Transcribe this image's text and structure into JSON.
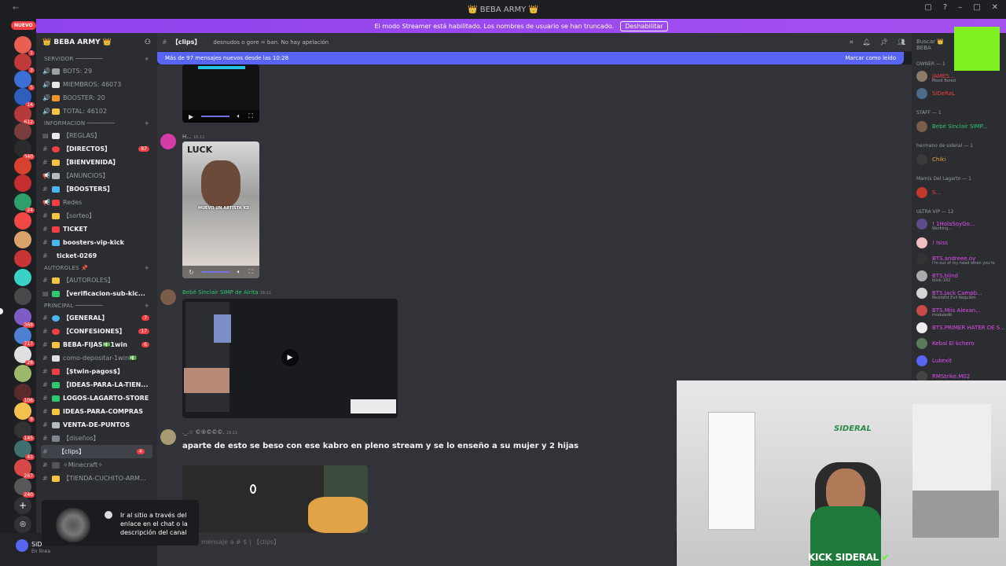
{
  "titlebar": {
    "title": "👑 BEBA ARMY 👑",
    "back": "←"
  },
  "banner": {
    "text": "El modo Streamer está habilitado. Los nombres de usuario se han truncado.",
    "button": "Deshabilitar"
  },
  "guild_bar": {
    "nuevo": "NUEVO"
  },
  "server": {
    "name": "👑 BEBA ARMY 👑"
  },
  "categories": {
    "servidor": "SERVIDOR ────────",
    "informacion": "INFORMACION ────────",
    "autoroles": "AUTOROLES 📌",
    "principal": "PRINCIPAL ────────"
  },
  "channels": [
    {
      "name": "BOTS: 29"
    },
    {
      "name": "MIEMBROS: 46073"
    },
    {
      "name": "BOOSTER: 20"
    },
    {
      "name": "TOTAL: 46102"
    },
    {
      "name": "【REGLAS】"
    },
    {
      "name": "【DIRECTOS】",
      "count": "87"
    },
    {
      "name": "【BIENVENIDA】"
    },
    {
      "name": "【ANUNCIOS】"
    },
    {
      "name": "【BOOSTERS】"
    },
    {
      "name": "Redes"
    },
    {
      "name": "【sorteo】"
    },
    {
      "name": "TICKET"
    },
    {
      "name": "boosters-vip-kick"
    },
    {
      "name": "ticket-0269"
    },
    {
      "name": "【AUTOROLES】"
    },
    {
      "name": "【verificacion-sub-kic..."
    },
    {
      "name": "【GENERAL】",
      "count": "7"
    },
    {
      "name": "【CONFESIONES】",
      "count": "17"
    },
    {
      "name": "BEBA-FIJAS💵1win",
      "count": "6"
    },
    {
      "name": "como-depositar-1win💵"
    },
    {
      "name": "【$twin-pagos$】"
    },
    {
      "name": "【IDEAS-PARA-LA-TIEN..."
    },
    {
      "name": "LOGOS-LAGARTO-STORE"
    },
    {
      "name": "IDEAS-PARA-COMPRAS"
    },
    {
      "name": "VENTA-DE-PUNTOS"
    },
    {
      "name": "【diseños】"
    },
    {
      "name": "【clips】",
      "count": "4"
    },
    {
      "name": "✧Minecraft✧"
    },
    {
      "name": "【TIENDA-CUCHITO-ARM..."
    }
  ],
  "user_panel": {
    "name": "SiD",
    "status": "En línea"
  },
  "topbar": {
    "channel": "【clips】",
    "topic": "desnudos o gore = ban. No hay apelación",
    "search": "Buscar 👑 BEBA"
  },
  "new_messages": {
    "text": "Más de 97 mensajes nuevos desde las 10:28",
    "mark": "Marcar como leído"
  },
  "messages": [
    {
      "author": "H...",
      "time": "16:11",
      "caption": "MUEVO UN ARTISTA XD"
    },
    {
      "author": "Bebé Sinclair SIMP de Airita",
      "time": "16:11"
    },
    {
      "author": "._.☆ ©®©©©.",
      "time": "16:11",
      "text": "aparte de esto se beso con ese kabro en pleno stream y se lo enseño a su mujer y 2 hijas"
    }
  ],
  "composer": {
    "placeholder": "mensaje a # $ | 【clips】"
  },
  "members": {
    "groups": [
      {
        "label": "OWNER — 1"
      },
      {
        "label": "STAFF — 1"
      },
      {
        "label": "hermano de sideral — 1"
      },
      {
        "label": "Mamis Del Lagarto — 1"
      },
      {
        "label": "ULTRA VIP — 12"
      }
    ],
    "people": [
      {
        "name": "JAMES...",
        "color": "#f23f43",
        "sub": "Mood Bored"
      },
      {
        "name": "SiDeRaL",
        "color": "#f23f43"
      },
      {
        "name": "Bebé Sinclair SIMP...",
        "color": "#2dc770"
      },
      {
        "name": "Chiki",
        "color": "#e8a23a"
      },
      {
        "name": "S...",
        "color": "#f23f43"
      },
      {
        "name": "! 1HolaSoyGo...",
        "color": "#e04ff0",
        "sub": "Working..."
      },
      {
        "name": "! Isiss",
        "color": "#e04ff0"
      },
      {
        "name": "BTS.andreee.oy",
        "color": "#e04ff0",
        "sub": "I'm out of my head when you're"
      },
      {
        "name": "BTS.blind",
        "color": "#e04ff0",
        "sub": "blink-182"
      },
      {
        "name": "BTS.Jack Campb...",
        "color": "#e04ff0",
        "sub": "Resident Evil Requiem"
      },
      {
        "name": "BTS.Miis Alexan...",
        "color": "#e04ff0",
        "sub": "moduledb"
      },
      {
        "name": "BTS.PRIMER HATER DE S...",
        "color": "#e04ff0"
      },
      {
        "name": "Kebal El kchero",
        "color": "#e04ff0"
      },
      {
        "name": "Lukexit",
        "color": "#e04ff0"
      },
      {
        "name": "RMStrike.M02",
        "color": "#e04ff0"
      }
    ]
  },
  "overlay": {
    "toast_text": "Ir al sitio a través del enlace en el chat o la descripción del canal",
    "kick_label": "KICK",
    "kick_name": "SIDERAL"
  },
  "colors": {
    "accent": "#5865f2",
    "streamer_banner": "#9b4bf0",
    "kick_green": "#53fc18"
  }
}
